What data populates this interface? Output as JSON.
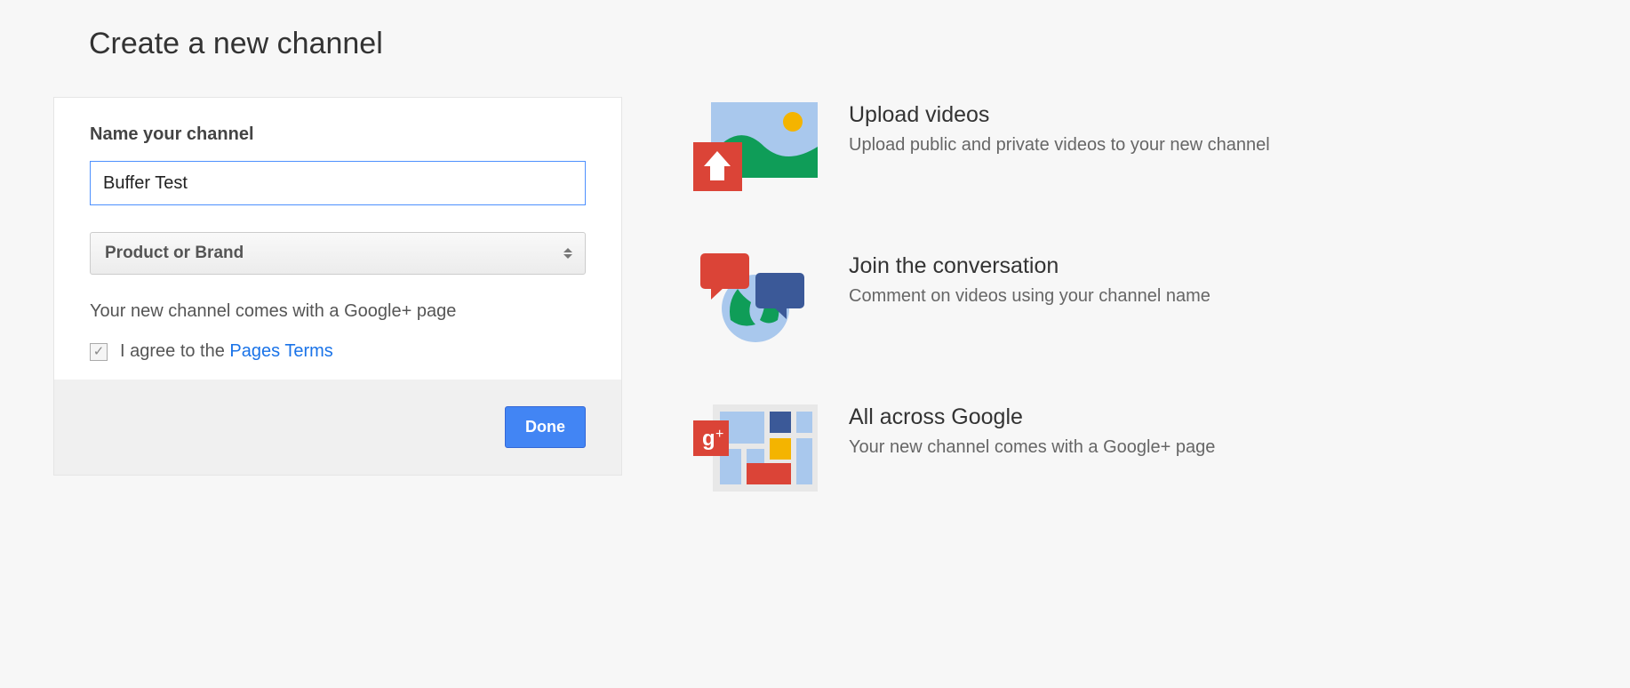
{
  "page": {
    "title": "Create a new channel"
  },
  "form": {
    "nameLabel": "Name your channel",
    "nameValue": "Buffer Test",
    "categorySelected": "Product or Brand",
    "infoText": "Your new channel comes with a Google+ page",
    "agreePrefix": "I agree to the ",
    "agreeLink": "Pages Terms",
    "doneLabel": "Done"
  },
  "benefits": [
    {
      "title": "Upload videos",
      "desc": "Upload public and private videos to your new channel"
    },
    {
      "title": "Join the conversation",
      "desc": "Comment on videos using your channel name"
    },
    {
      "title": "All across Google",
      "desc": "Your new channel comes with a Google+ page"
    }
  ]
}
